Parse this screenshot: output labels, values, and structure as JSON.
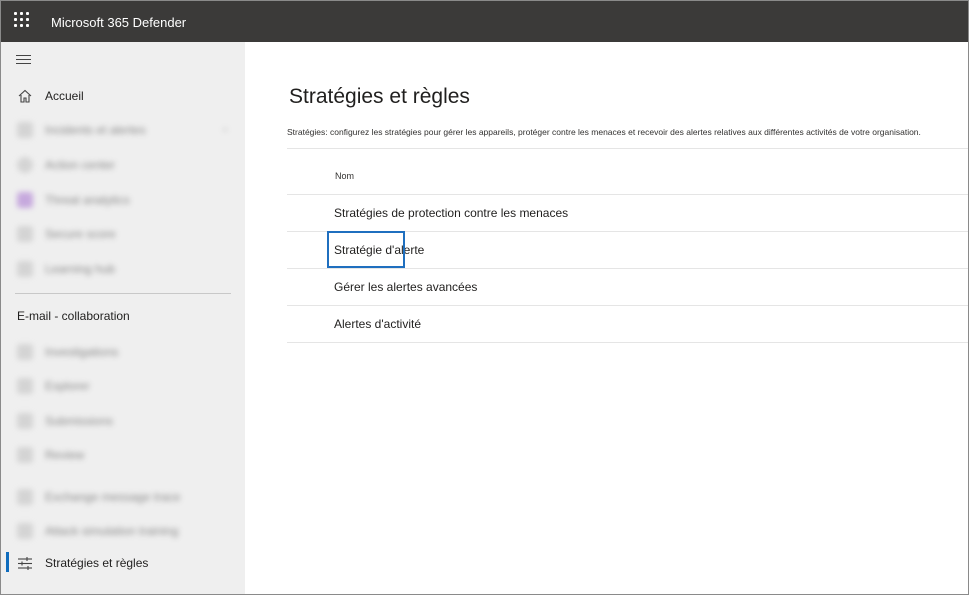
{
  "header": {
    "app_title": "Microsoft 365 Defender",
    "waffle_icon": "app-launcher-icon",
    "background": "#3b3a39"
  },
  "sidebar": {
    "collapse_icon": "hamburger-icon",
    "home": {
      "label": "Accueil",
      "icon": "home-icon"
    },
    "blurred_items_top": [
      {
        "label": "Incidents et alertes",
        "icon": "incidents-icon",
        "has_chevron": true
      },
      {
        "label": "Action center",
        "icon": "action-icon"
      },
      {
        "label": "Threat analytics",
        "icon": "threat-icon"
      },
      {
        "label": "Secure score",
        "icon": "score-icon"
      },
      {
        "label": "Learning hub",
        "icon": "learning-icon"
      }
    ],
    "section_label": "E-mail - collaboration",
    "blurred_items_section": [
      {
        "label": "Investigations",
        "icon": "investigations-icon"
      },
      {
        "label": "Explorer",
        "icon": "explorer-icon"
      },
      {
        "label": "Submissions",
        "icon": "submissions-icon"
      },
      {
        "label": "Review",
        "icon": "review-icon"
      },
      {
        "label": "Exchange message trace",
        "icon": "message-trace-icon"
      },
      {
        "label": "Attack simulation training",
        "icon": "attack-sim-icon"
      }
    ],
    "active_item": {
      "label": "Stratégies et règles",
      "icon": "policies-sliders-icon"
    },
    "accent": "#0f6cbd"
  },
  "main": {
    "title": "Stratégies et règles",
    "description": "Stratégies: configurez les stratégies pour gérer les appareils, protéger contre les menaces et recevoir des alertes relatives aux différentes activités de votre organisation.",
    "column_header": "Nom",
    "rows": [
      "Stratégies de protection contre les menaces",
      "Stratégie d'alerte",
      "Gérer les alertes avancées",
      "Alertes d'activité"
    ],
    "highlight_color": "#1f6fbf"
  }
}
